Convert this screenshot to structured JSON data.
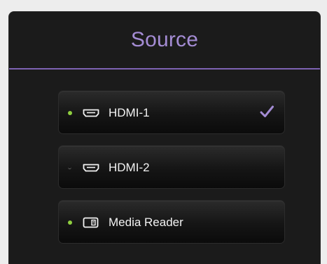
{
  "panel": {
    "title": "Source"
  },
  "sources": [
    {
      "label": "HDMI-1",
      "icon": "hdmi-port-icon",
      "status": "connected",
      "selected": true
    },
    {
      "label": "HDMI-2",
      "icon": "hdmi-port-icon",
      "status": "disconnected",
      "selected": false
    },
    {
      "label": "Media Reader",
      "icon": "media-reader-icon",
      "status": "connected",
      "selected": false
    }
  ],
  "colors": {
    "accent": "#a48cd4",
    "divider": "#7d63b3",
    "status_connected": "#8fcf3f",
    "check": "#a48cd4"
  }
}
